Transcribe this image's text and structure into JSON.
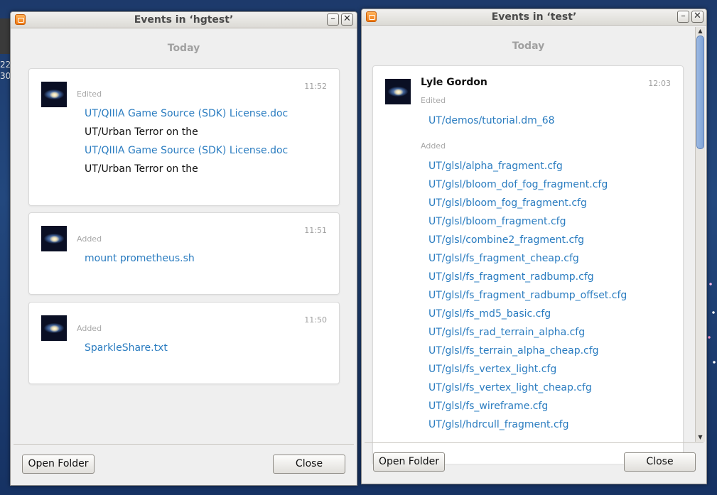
{
  "desktop": {
    "clock_line1": "22",
    "clock_line2": "30"
  },
  "window_left": {
    "title": "Events in ‘hgtest’",
    "minimize": "–",
    "close_x": "✕",
    "day": "Today",
    "events": [
      {
        "time": "11:52",
        "label": "Edited",
        "files": [
          {
            "text": "UT/QIIIA Game Source (SDK) License.doc",
            "link": true
          },
          {
            "text": "UT/Urban Terror on the",
            "link": false
          },
          {
            "text": "UT/QIIIA Game Source (SDK) License.doc",
            "link": true
          },
          {
            "text": "UT/Urban Terror on the",
            "link": false
          }
        ]
      },
      {
        "time": "11:51",
        "label": "Added",
        "files": [
          {
            "text": "mount prometheus.sh",
            "link": true
          }
        ]
      },
      {
        "time": "11:50",
        "label": "Added",
        "files": [
          {
            "text": "SparkleShare.txt",
            "link": true
          }
        ]
      }
    ],
    "open_folder": "Open Folder",
    "close": "Close"
  },
  "window_right": {
    "title": "Events in ‘test’",
    "minimize": "–",
    "close_x": "✕",
    "day": "Today",
    "event": {
      "author": "Lyle Gordon",
      "time": "12:03",
      "edited_label": "Edited",
      "edited_files": [
        "UT/demos/tutorial.dm_68"
      ],
      "added_label": "Added",
      "added_files": [
        "UT/glsl/alpha_fragment.cfg",
        "UT/glsl/bloom_dof_fog_fragment.cfg",
        "UT/glsl/bloom_fog_fragment.cfg",
        "UT/glsl/bloom_fragment.cfg",
        "UT/glsl/combine2_fragment.cfg",
        "UT/glsl/fs_fragment_cheap.cfg",
        "UT/glsl/fs_fragment_radbump.cfg",
        "UT/glsl/fs_fragment_radbump_offset.cfg",
        "UT/glsl/fs_md5_basic.cfg",
        "UT/glsl/fs_rad_terrain_alpha.cfg",
        "UT/glsl/fs_terrain_alpha_cheap.cfg",
        "UT/glsl/fs_vertex_light.cfg",
        "UT/glsl/fs_vertex_light_cheap.cfg",
        "UT/glsl/fs_wireframe.cfg",
        "UT/glsl/hdrcull_fragment.cfg"
      ]
    },
    "open_folder": "Open Folder",
    "close": "Close"
  },
  "colors": {
    "link": "#2a7cc0",
    "muted": "#a0a0a0",
    "title_text": "#4a4a4a"
  }
}
